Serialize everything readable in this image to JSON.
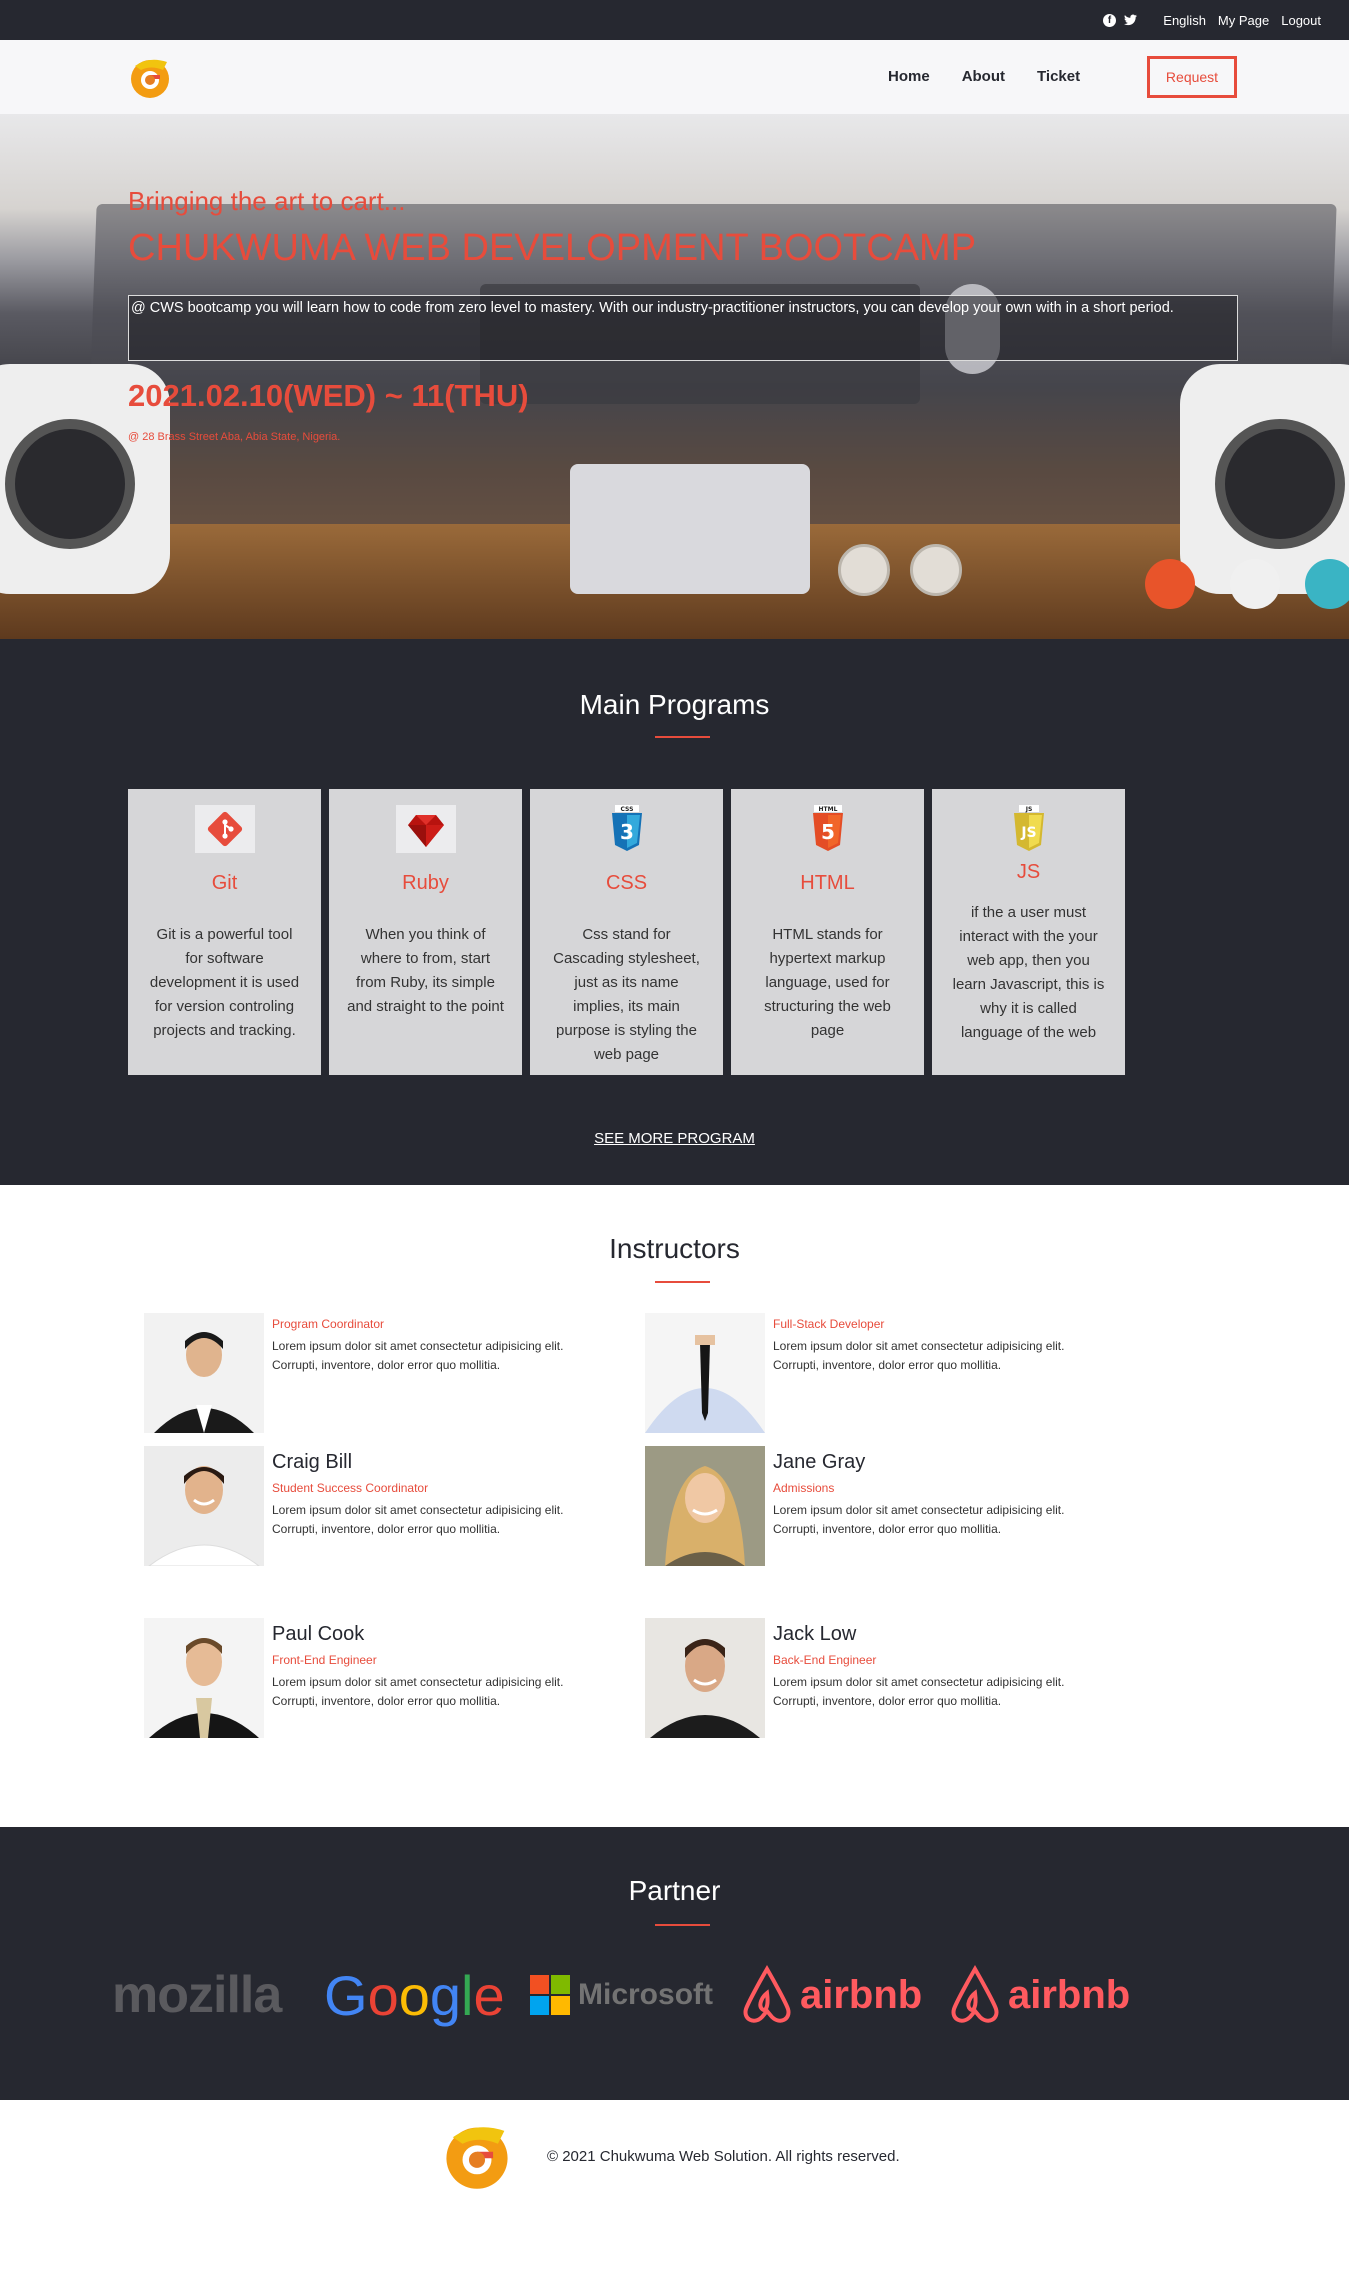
{
  "topbar": {
    "social_icons": [
      "facebook-icon",
      "twitter-icon"
    ],
    "links": [
      "English",
      "My Page",
      "Logout"
    ]
  },
  "nav": {
    "items": [
      "Home",
      "About",
      "Ticket"
    ],
    "request_label": "Request"
  },
  "hero": {
    "kicker": "Bringing the art to cart...",
    "title": "CHUKWUMA WEB DEVELOPMENT BOOTCAMP",
    "description": "@ CWS bootcamp you will learn how to code from zero level to mastery. With our industry-practitioner instructors, you can develop your own with in a short period.",
    "date": "2021.02.10(WED) ~ 11(THU)",
    "address": "@ 28 Brass Street Aba, Abia State, Nigeria."
  },
  "programs": {
    "title": "Main Programs",
    "items": [
      {
        "name": "Git",
        "icon": "git-icon",
        "text": "Git is a powerful tool for software development it is used for version controling projects and tracking."
      },
      {
        "name": "Ruby",
        "icon": "ruby-icon",
        "text": "When you think of where to from, start from Ruby, its simple and straight to the point"
      },
      {
        "name": "CSS",
        "icon": "css3-icon",
        "text": "Css stand for Cascading stylesheet, just as its name implies, its main purpose is styling the web page"
      },
      {
        "name": "HTML",
        "icon": "html5-icon",
        "text": "HTML stands for hypertext markup language, used for structuring the web page"
      },
      {
        "name": "JS",
        "icon": "js-icon",
        "text": "if the a user must interact with the your web app, then you learn Javascript, this is why it is called language of the web"
      }
    ],
    "see_more": "SEE MORE PROGRAM",
    "css_badge": "CSS",
    "html_badge": "HTML",
    "js_badge": "JS"
  },
  "instructors": {
    "title": "Instructors",
    "lorem": "Lorem ipsum dolor sit amet consectetur adipisicing elit. Corrupti, inventore, dolor error quo mollitia.",
    "items": [
      {
        "name": "",
        "role": "Program Coordinator"
      },
      {
        "name": "",
        "role": "Full-Stack Developer"
      },
      {
        "name": "Craig Bill",
        "role": "Student Success Coordinator"
      },
      {
        "name": "Jane Gray",
        "role": "Admissions"
      },
      {
        "name": "Paul Cook",
        "role": "Front-End Engineer"
      },
      {
        "name": "Jack Low",
        "role": "Back-End Engineer"
      }
    ]
  },
  "partner": {
    "title": "Partner",
    "brands": [
      "mozilla",
      "Google",
      "Microsoft",
      "airbnb",
      "airbnb"
    ]
  },
  "footer": {
    "copyright": "© 2021 Chukwuma Web Solution. All rights reserved."
  },
  "colors": {
    "accent": "#e74c3c",
    "dark": "#262830",
    "card": "#d6d6d8"
  }
}
